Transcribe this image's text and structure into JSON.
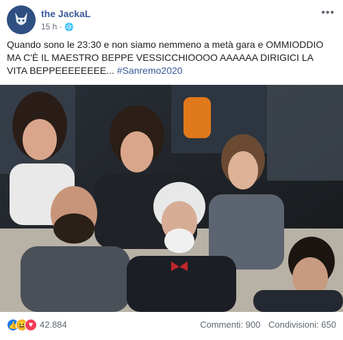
{
  "header": {
    "author": "the JackaL",
    "time": "15 h",
    "separator": "·",
    "visibility_icon": "globe-icon",
    "more_icon": "more-options-icon",
    "more_glyph": "•••"
  },
  "post": {
    "text": "Quando sono le 23:30 e non siamo nemmeno a metà gara e OMMIODDIO MA C'È IL MAESTRO BEPPE VESSICCHIOOOO AAAAAA DIRIGICI LA VITA BEPPEEEEEEEE... ",
    "hashtag": "#Sanremo2020"
  },
  "footer": {
    "reaction_icons": [
      "like-icon",
      "haha-icon",
      "love-icon"
    ],
    "reaction_count": "42.884",
    "comments": "Commenti: 900",
    "shares": "Condivisioni: 650"
  },
  "colors": {
    "link": "#385898",
    "like": "#1877f2",
    "haha": "#f7b125",
    "love": "#f33e58"
  }
}
